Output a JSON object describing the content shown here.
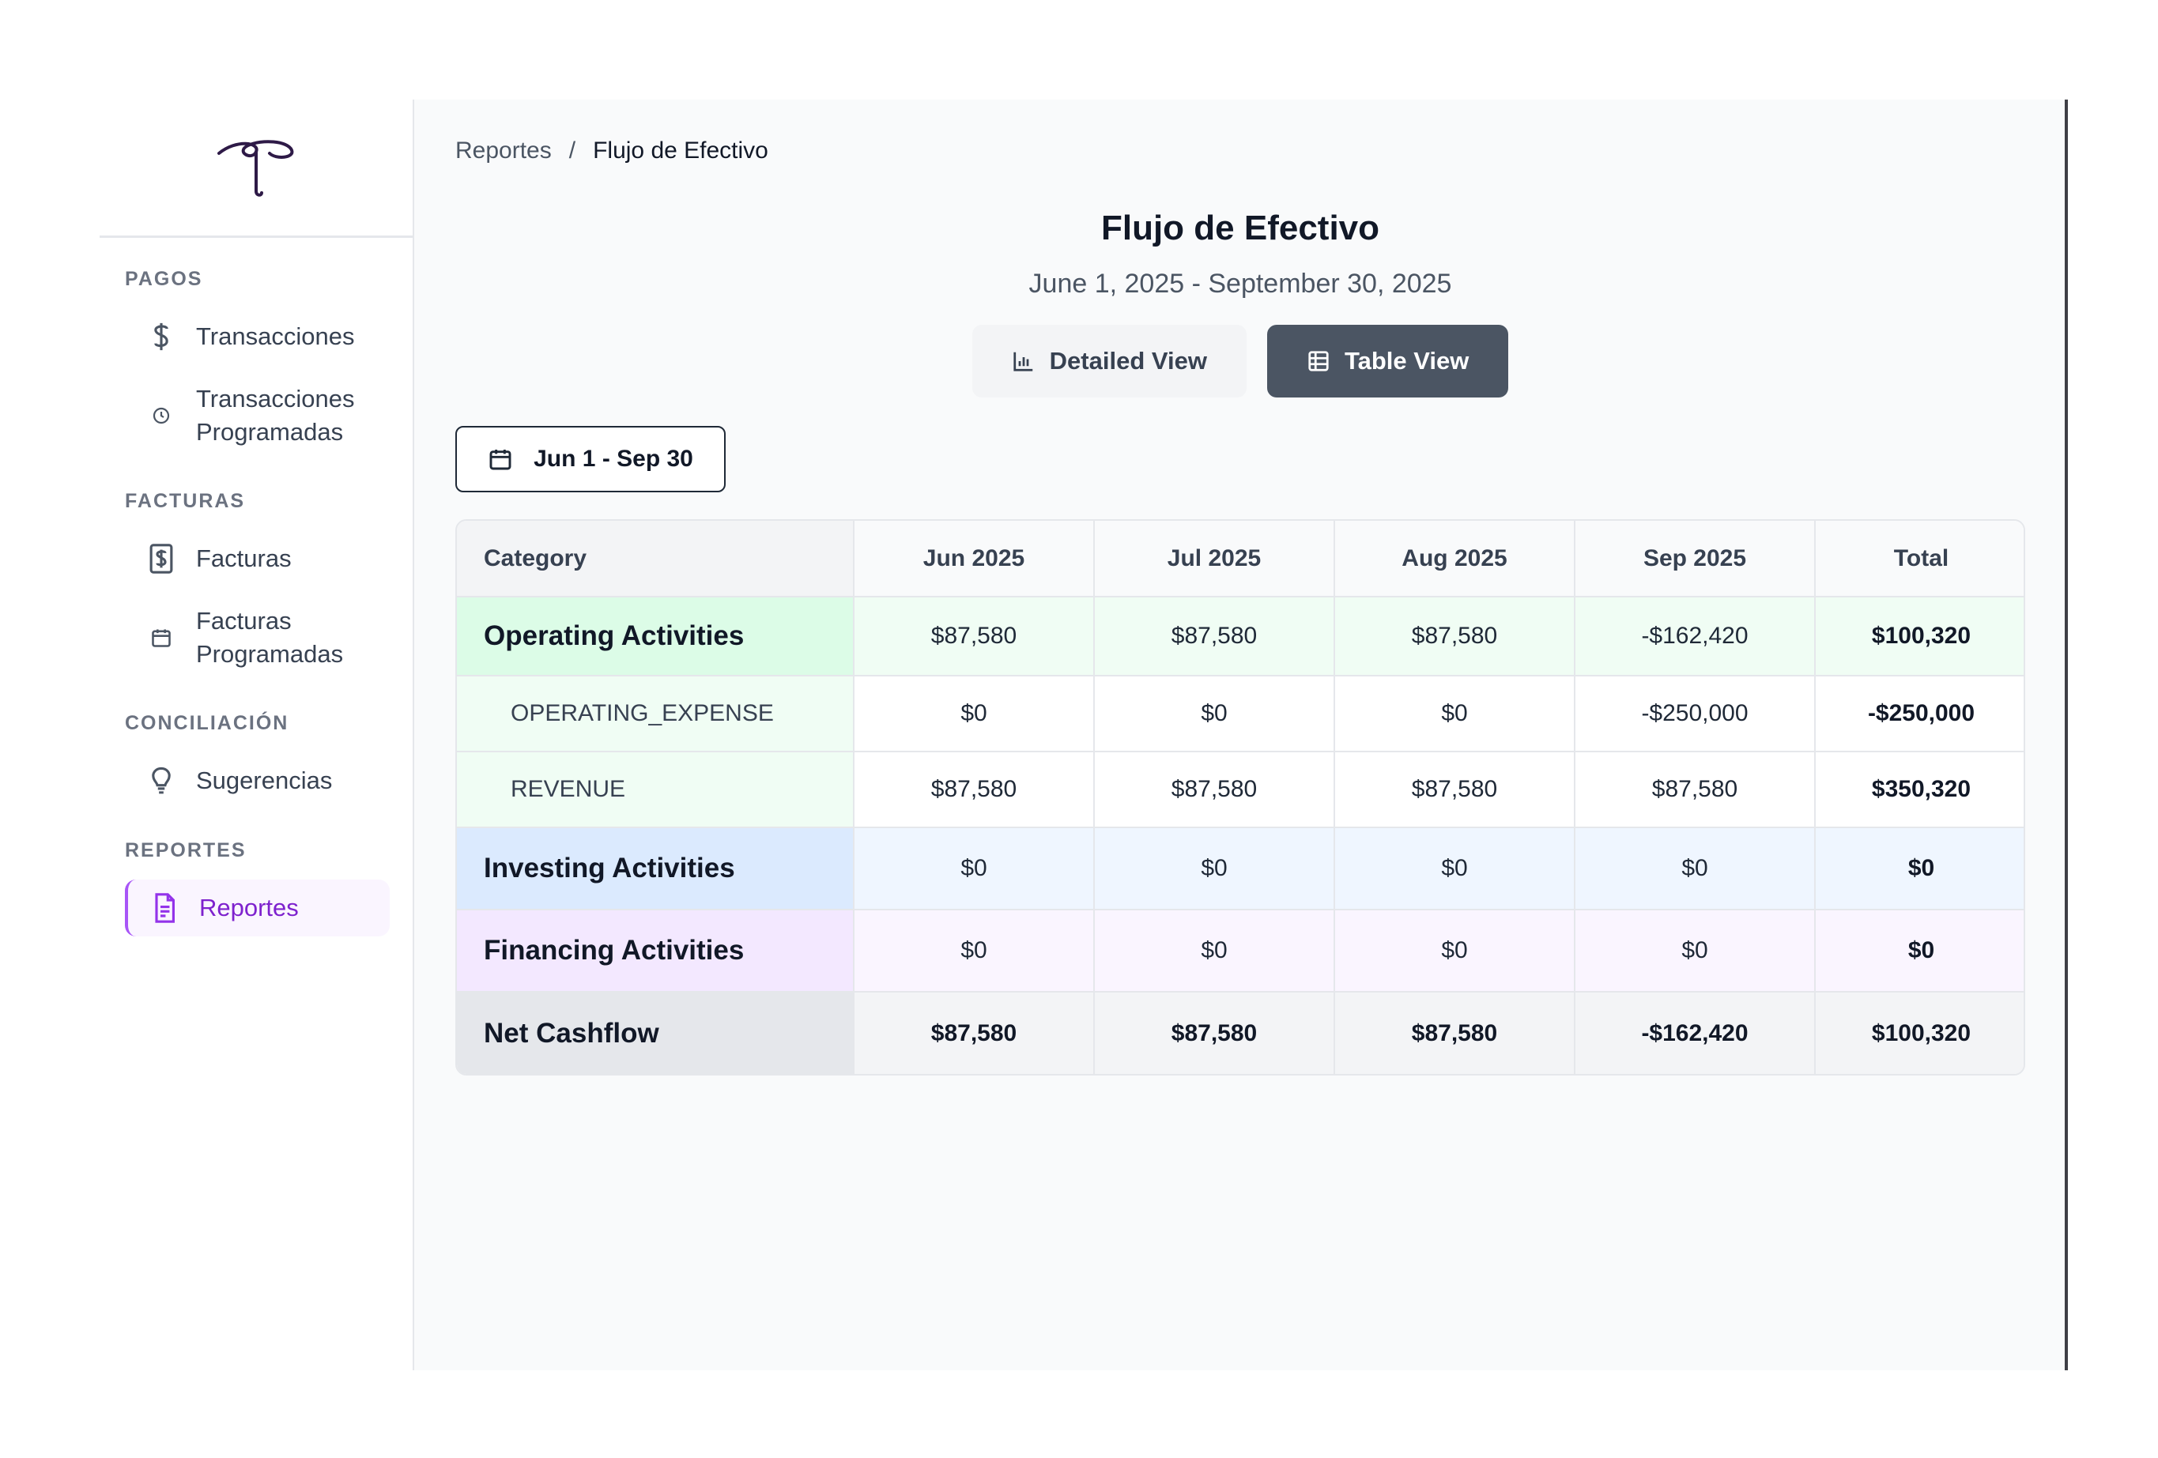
{
  "sidebar": {
    "sections": [
      {
        "heading": "PAGOS",
        "items": [
          {
            "label": "Transacciones",
            "icon": "dollar-icon"
          },
          {
            "label": "Transacciones Programadas",
            "icon": "clock-icon"
          }
        ]
      },
      {
        "heading": "FACTURAS",
        "items": [
          {
            "label": "Facturas",
            "icon": "invoice-dollar-icon"
          },
          {
            "label": "Facturas Programadas",
            "icon": "calendar-icon"
          }
        ]
      },
      {
        "heading": "CONCILIACIÓN",
        "items": [
          {
            "label": "Sugerencias",
            "icon": "lightbulb-icon"
          }
        ]
      },
      {
        "heading": "REPORTES",
        "items": [
          {
            "label": "Reportes",
            "icon": "document-icon",
            "active": true
          }
        ]
      }
    ]
  },
  "breadcrumb": {
    "parent": "Reportes",
    "separator": "/",
    "current": "Flujo de Efectivo"
  },
  "report": {
    "title": "Flujo de Efectivo",
    "subtitle": "June 1, 2025 - September 30, 2025"
  },
  "view_toggle": {
    "detailed": "Detailed View",
    "table": "Table View",
    "selected": "table"
  },
  "date_range": {
    "label": "Jun 1 - Sep 30"
  },
  "table": {
    "headers": [
      "Category",
      "Jun 2025",
      "Jul 2025",
      "Aug 2025",
      "Sep 2025",
      "Total"
    ],
    "rows": [
      {
        "type": "group-operating",
        "cells": [
          "Operating Activities",
          "$87,580",
          "$87,580",
          "$87,580",
          "-$162,420",
          "$100,320"
        ]
      },
      {
        "type": "sub",
        "cells": [
          "OPERATING_EXPENSE",
          "$0",
          "$0",
          "$0",
          "-$250,000",
          "-$250,000"
        ]
      },
      {
        "type": "sub",
        "cells": [
          "REVENUE",
          "$87,580",
          "$87,580",
          "$87,580",
          "$87,580",
          "$350,320"
        ]
      },
      {
        "type": "group-investing",
        "cells": [
          "Investing Activities",
          "$0",
          "$0",
          "$0",
          "$0",
          "$0"
        ]
      },
      {
        "type": "group-financing",
        "cells": [
          "Financing Activities",
          "$0",
          "$0",
          "$0",
          "$0",
          "$0"
        ]
      },
      {
        "type": "net",
        "cells": [
          "Net Cashflow",
          "$87,580",
          "$87,580",
          "$87,580",
          "-$162,420",
          "$100,320"
        ]
      }
    ]
  },
  "colors": {
    "accent": "#9333ea",
    "operating": "#dcfce7",
    "investing": "#dbeafe",
    "financing": "#f3e8ff",
    "net": "#e5e7eb",
    "table_view_button": "#4b5563"
  }
}
